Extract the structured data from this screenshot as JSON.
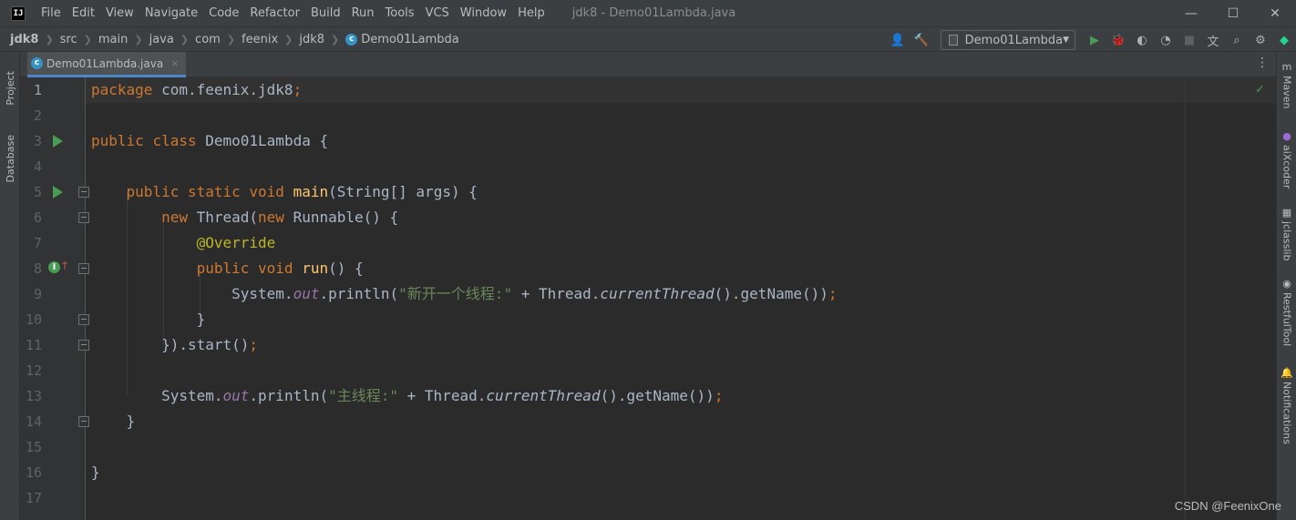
{
  "app": {
    "logo_text": "IJ",
    "window_title": "jdk8 - Demo01Lambda.java"
  },
  "menu": [
    "File",
    "Edit",
    "View",
    "Navigate",
    "Code",
    "Refactor",
    "Build",
    "Run",
    "Tools",
    "VCS",
    "Window",
    "Help"
  ],
  "window_controls": {
    "minimize": "—",
    "maximize": "☐",
    "close": "✕"
  },
  "breadcrumb": [
    "jdk8",
    "src",
    "main",
    "java",
    "com",
    "feenix",
    "jdk8",
    "Demo01Lambda"
  ],
  "toolbar": {
    "run_config": "Demo01Lambda",
    "icons": [
      "user-icon",
      "build-hammer-icon",
      "run-icon",
      "debug-icon",
      "coverage-icon",
      "profile-icon",
      "stop-icon",
      "translate-icon",
      "search-icon",
      "settings-icon",
      "jetbrains-toolbox-icon"
    ]
  },
  "left_tools": [
    "Project",
    "Database"
  ],
  "right_tools": [
    "Maven",
    "aiXcoder",
    "jclasslib",
    "RestfulTool",
    "Notifications"
  ],
  "tab": {
    "label": "Demo01Lambda.java",
    "close": "×"
  },
  "editor": {
    "line_numbers": [
      "1",
      "2",
      "3",
      "4",
      "5",
      "6",
      "7",
      "8",
      "9",
      "10",
      "11",
      "12",
      "13",
      "14",
      "15",
      "16",
      "17"
    ],
    "current_line": 1,
    "run_gutter_lines": [
      3,
      5
    ],
    "override_line": 8,
    "fold_lines": [
      5,
      6,
      8,
      10,
      11,
      14
    ],
    "code": {
      "l1": {
        "kw": "package",
        "rest": " com.feenix.jdk8",
        "semi": ";"
      },
      "l3": {
        "kw1": "public",
        "kw2": "class",
        "name": " Demo01Lambda {"
      },
      "l5": {
        "kw": "public static void",
        "fn": "main",
        "rest": "(String[] args) {"
      },
      "l6": {
        "kw1": "new",
        "mid": " Thread(",
        "kw2": "new",
        "rest": " Runnable() {"
      },
      "l7": {
        "ann": "@Override"
      },
      "l8": {
        "kw": "public void",
        "fn": "run",
        "rest": "() {"
      },
      "l9": {
        "a": "System.",
        "fld": "out",
        "b": ".println(",
        "str": "\"新开一个线程:\"",
        "c": " + Thread.",
        "ital": "currentThread",
        "d": "().getName())",
        "semi": ";"
      },
      "l10": {
        "text": "}"
      },
      "l11": {
        "text": "}).start()",
        "semi": ";"
      },
      "l13": {
        "a": "System.",
        "fld": "out",
        "b": ".println(",
        "str": "\"主线程:\"",
        "c": " + Thread.",
        "ital": "currentThread",
        "d": "().getName())",
        "semi": ";"
      },
      "l14": {
        "text": "}"
      },
      "l16": {
        "text": "}"
      }
    }
  },
  "status": {
    "check": "✓"
  },
  "watermark": "CSDN @FeenixOne"
}
